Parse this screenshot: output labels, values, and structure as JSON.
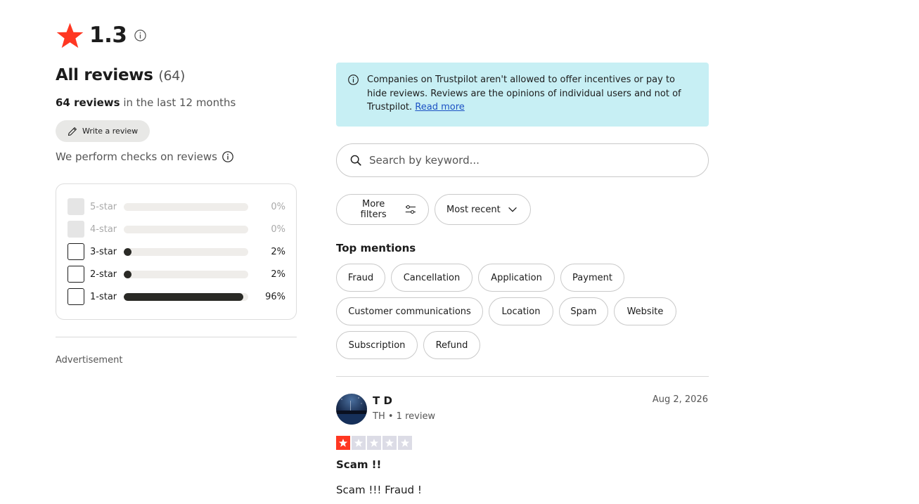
{
  "summary": {
    "rating": "1.3",
    "star_color": "#ff3722",
    "info_icon": "info-icon",
    "all_reviews_label": "All reviews",
    "all_reviews_count": "(64)",
    "last12_count": "64 reviews",
    "last12_suffix": " in the last 12 months",
    "write_review_label": "Write a review",
    "checks_label": "We perform checks on reviews",
    "advertisement_label": "Advertisement"
  },
  "distribution": [
    {
      "label": "5-star",
      "percent_text": "0%",
      "percent": 0,
      "enabled": false
    },
    {
      "label": "4-star",
      "percent_text": "0%",
      "percent": 0,
      "enabled": false
    },
    {
      "label": "3-star",
      "percent_text": "2%",
      "percent": 2,
      "enabled": true
    },
    {
      "label": "2-star",
      "percent_text": "2%",
      "percent": 2,
      "enabled": true
    },
    {
      "label": "1-star",
      "percent_text": "96%",
      "percent": 96,
      "enabled": true
    }
  ],
  "notice": {
    "text": "Companies on Trustpilot aren't allowed to offer incentives or pay to hide reviews. Reviews are the opinions of individual users and not of Trustpilot. ",
    "link": "Read more",
    "bg_color": "#c7eff4"
  },
  "search": {
    "placeholder": "Search by keyword..."
  },
  "filters": {
    "more_filters": "More filters",
    "sort": "Most recent"
  },
  "top_mentions": {
    "heading": "Top mentions",
    "chips": [
      "Fraud",
      "Cancellation",
      "Application",
      "Payment",
      "Customer communications",
      "Location",
      "Spam",
      "Website",
      "Subscription",
      "Refund"
    ]
  },
  "review": {
    "name": "T D",
    "country": "TH",
    "review_count": "1 review",
    "date": "Aug 2, 2026",
    "stars": 1,
    "title": "Scam !!",
    "body": "Scam !!! Fraud !"
  }
}
